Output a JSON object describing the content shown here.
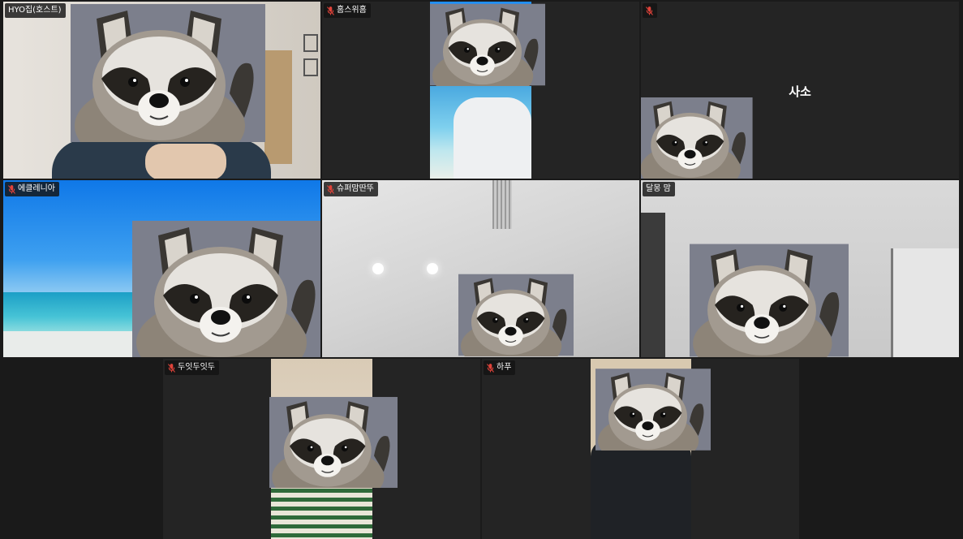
{
  "participants": [
    {
      "id": "hyo",
      "name": "HYO집(호스트)",
      "muted": false
    },
    {
      "id": "homeschool",
      "name": "홈스위홈",
      "muted": true
    },
    {
      "id": "saso",
      "name": "사소",
      "muted": true
    },
    {
      "id": "ekklesia",
      "name": "에클레니아",
      "muted": true
    },
    {
      "id": "superdad",
      "name": "슈퍼맘딴뚜",
      "muted": true
    },
    {
      "id": "dalmom",
      "name": "달몽 맘",
      "muted": false
    },
    {
      "id": "doit",
      "name": "두잇두잇두",
      "muted": true
    },
    {
      "id": "hapu",
      "name": "하푸",
      "muted": true
    }
  ],
  "icons": {
    "muted": "mic-muted-icon",
    "raccoon": "raccoon-overlay-icon"
  },
  "colors": {
    "background": "#1a1a1a",
    "tile": "#242424",
    "muted_mic": "#e0433a"
  }
}
